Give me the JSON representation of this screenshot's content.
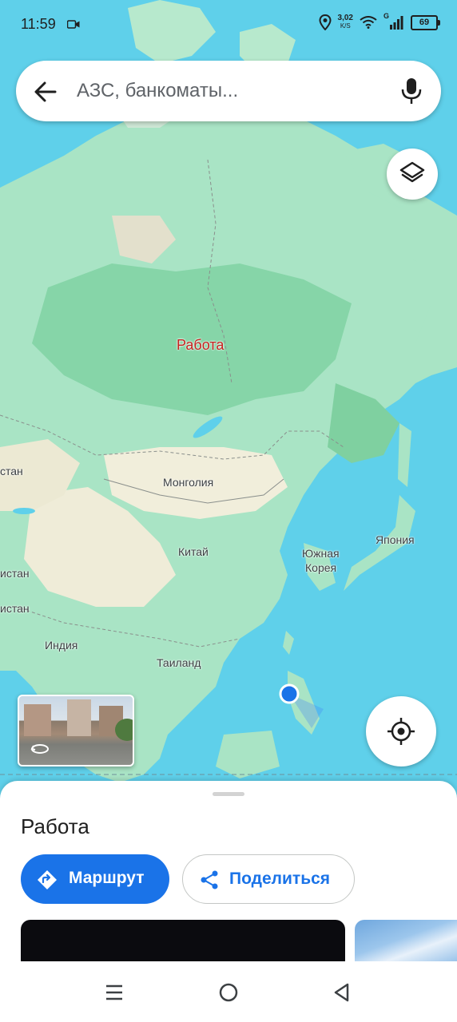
{
  "status_bar": {
    "time": "11:59",
    "net_speed": "3,02",
    "net_unit": "K/S",
    "signal_type": "G",
    "battery": "69"
  },
  "search": {
    "placeholder": "АЗС, банкоматы..."
  },
  "map": {
    "pin_label": "Работа",
    "labels": {
      "mongolia": "Монголия",
      "china": "Китай",
      "south_korea_1": "Южная",
      "south_korea_2": "Корея",
      "japan": "Япония",
      "india": "Индия",
      "thailand": "Таиланд",
      "stan_1": "стан",
      "stan_2": "истан",
      "stan_3": "истан"
    }
  },
  "sheet": {
    "title": "Работа",
    "route_label": "Маршрут",
    "share_label": "Поделиться"
  },
  "colors": {
    "accent": "#1a73e8",
    "water": "#5fd0ea",
    "land": "#a9e4c5",
    "pin_text": "#c5221f"
  },
  "icons": [
    "video-icon",
    "location-status-icon",
    "wifi-icon",
    "signal-icon",
    "battery-icon",
    "back-arrow-icon",
    "mic-icon",
    "layers-icon",
    "streetview-rotate-icon",
    "my-location-icon",
    "directions-icon",
    "share-icon",
    "menu-icon",
    "home-icon",
    "back-nav-icon"
  ]
}
